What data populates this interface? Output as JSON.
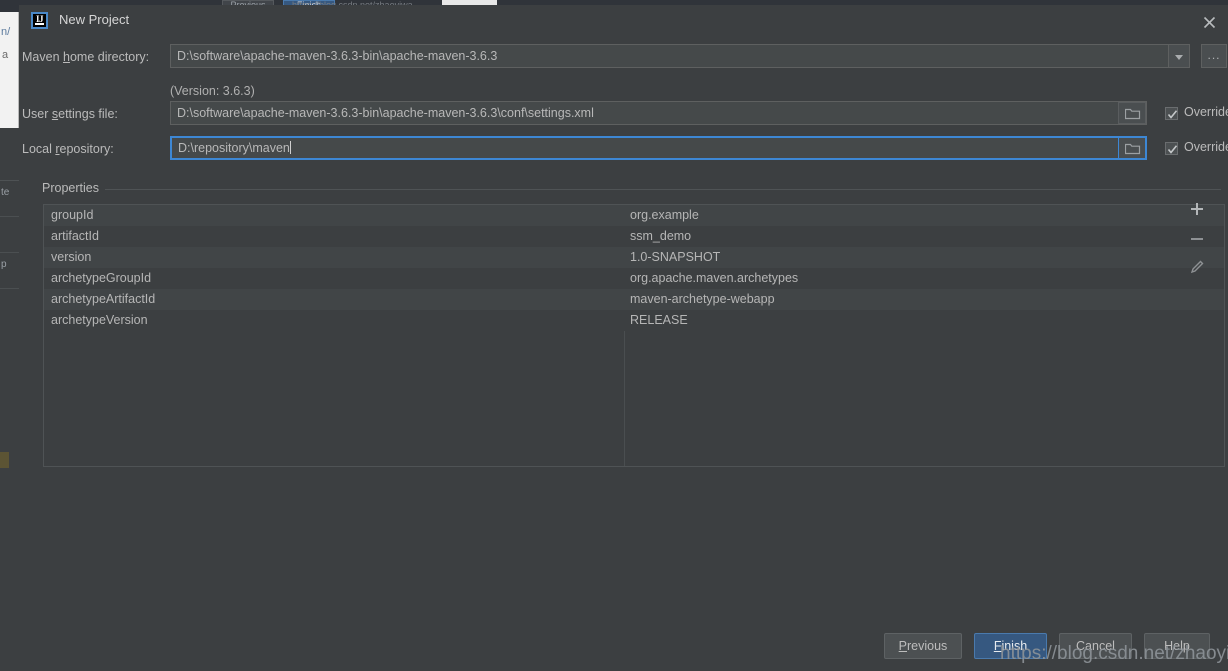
{
  "backdrop": {
    "ghost_previous_label": "Previous",
    "ghost_finish_label": "Finish",
    "ghost_url": "https://blog.csdn.net/zhaoyiwa",
    "left_fragment_top": "n/",
    "left_fragment_second": "a",
    "left_rows": [
      "te",
      "",
      "p"
    ]
  },
  "dialog": {
    "title": "New Project",
    "icon": "intellij-idea-icon",
    "close_icon": "close-icon"
  },
  "form": {
    "maven_home": {
      "label_pre": "Maven ",
      "label_mnemonic": "h",
      "label_post": "ome directory:",
      "value": "D:\\software\\apache-maven-3.6.3-bin\\apache-maven-3.6.3",
      "dropdown_icon": "chevron-down-icon",
      "browse_label": "...",
      "version_note": "(Version: 3.6.3)"
    },
    "user_settings": {
      "label_pre": "User ",
      "label_mnemonic": "s",
      "label_post": "ettings file:",
      "value": "D:\\software\\apache-maven-3.6.3-bin\\apache-maven-3.6.3\\conf\\settings.xml",
      "folder_icon": "folder-icon",
      "override_label": "Override",
      "override_checked": true
    },
    "local_repository": {
      "label_pre": "Local ",
      "label_mnemonic": "r",
      "label_post": "epository:",
      "value": "D:\\repository\\maven",
      "focused": true,
      "folder_icon": "folder-icon",
      "override_label": "Override",
      "override_checked": true
    }
  },
  "properties": {
    "legend": "Properties",
    "rows": [
      {
        "key": "groupId",
        "value": "org.example"
      },
      {
        "key": "artifactId",
        "value": "ssm_demo"
      },
      {
        "key": "version",
        "value": "1.0-SNAPSHOT"
      },
      {
        "key": "archetypeGroupId",
        "value": "org.apache.maven.archetypes"
      },
      {
        "key": "archetypeArtifactId",
        "value": "maven-archetype-webapp"
      },
      {
        "key": "archetypeVersion",
        "value": "RELEASE"
      }
    ],
    "toolbar": {
      "add_icon": "plus-icon",
      "remove_icon": "minus-icon",
      "edit_icon": "pencil-icon"
    }
  },
  "buttons": {
    "previous": {
      "pre": "",
      "mnemonic": "P",
      "post": "revious"
    },
    "finish": {
      "pre": "",
      "mnemonic": "F",
      "post": "inish"
    },
    "cancel": {
      "label": "Cancel"
    },
    "help": {
      "label": "Help"
    }
  },
  "watermark": {
    "text": "https://blog.csdn.net/zhaoyiwa"
  },
  "colors": {
    "dialog_bg": "#3c3f41",
    "field_bg": "#45494a",
    "focus_border": "#3d87d4",
    "primary_button": "#365880",
    "text": "#bbbbbb"
  }
}
